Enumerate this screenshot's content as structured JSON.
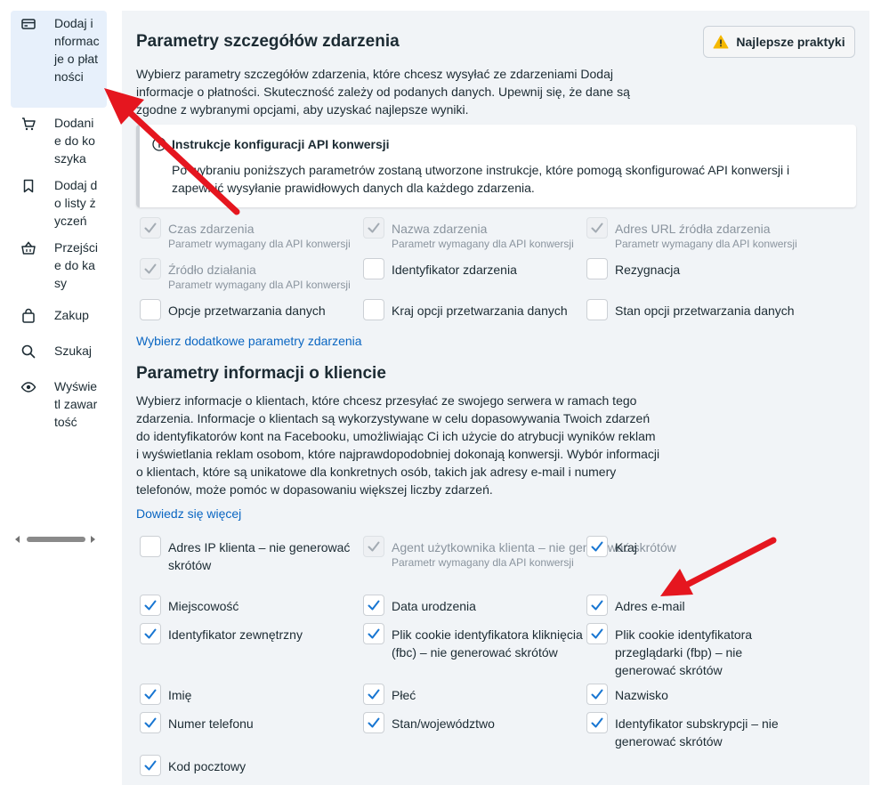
{
  "sidebar": {
    "items": [
      {
        "label": "Dodaj informacje o płatności",
        "icon": "credit-card-icon",
        "active": true
      },
      {
        "label": "Dodanie do koszyka",
        "icon": "cart-icon",
        "active": false
      },
      {
        "label": "Dodaj do listy życzeń",
        "icon": "bookmark-icon",
        "active": false
      },
      {
        "label": "Przejście do kasy",
        "icon": "basket-icon",
        "active": false
      },
      {
        "label": "Zakup",
        "icon": "shopping-bag-icon",
        "active": false
      },
      {
        "label": "Szukaj",
        "icon": "search-icon",
        "active": false
      },
      {
        "label": "Wyświetl zawartość",
        "icon": "eye-icon",
        "active": false
      }
    ]
  },
  "event_params": {
    "title": "Parametry szczegółów zdarzenia",
    "best_practices_label": "Najlepsze praktyki",
    "description": "Wybierz parametry szczegółów zdarzenia, które chcesz wysyłać ze zdarzeniami Dodaj informacje o płatności. Skuteczność zależy od podanych danych. Upewnij się, że dane są zgodne z wybranymi opcjami, aby uzyskać najlepsze wyniki.",
    "info_title": "Instrukcje konfiguracji API konwersji",
    "info_body": "Po wybraniu poniższych parametrów zostaną utworzone instrukcje, które pomogą skonfigurować API konwersji i zapewnić wysyłanie prawidłowych danych dla każdego zdarzenia.",
    "options": [
      {
        "label": "Czas zdarzenia",
        "sub": "Parametr wymagany dla API konwersji",
        "checked": true,
        "disabled": true
      },
      {
        "label": "Nazwa zdarzenia",
        "sub": "Parametr wymagany dla API konwersji",
        "checked": true,
        "disabled": true
      },
      {
        "label": "Adres URL źródła zdarzenia",
        "sub": "Parametr wymagany dla API konwersji",
        "checked": true,
        "disabled": true
      },
      {
        "label": "Źródło działania",
        "sub": "Parametr wymagany dla API konwersji",
        "checked": true,
        "disabled": true
      },
      {
        "label": "Identyfikator zdarzenia",
        "checked": false,
        "disabled": false
      },
      {
        "label": "Rezygnacja",
        "checked": false,
        "disabled": false
      },
      {
        "label": "Opcje przetwarzania danych",
        "checked": false,
        "disabled": false
      },
      {
        "label": "Kraj opcji przetwarzania danych",
        "checked": false,
        "disabled": false
      },
      {
        "label": "Stan opcji przetwarzania danych",
        "checked": false,
        "disabled": false
      }
    ],
    "more_link": "Wybierz dodatkowe parametry zdarzenia"
  },
  "customer_params": {
    "title": "Parametry informacji o kliencie",
    "description": "Wybierz informacje o klientach, które chcesz przesyłać ze swojego serwera w ramach tego zdarzenia. Informacje o klientach są wykorzystywane w celu dopasowywania Twoich zdarzeń do identyfikatorów kont na Facebooku, umożliwiając Ci ich użycie do atrybucji wyników reklam i wyświetlania reklam osobom, które najprawdopodobniej dokonają konwersji. Wybór informacji o klientach, które są unikatowe dla konkretnych osób, takich jak adresy e-mail i numery telefonów, może pomóc w dopasowaniu większej liczby zdarzeń.",
    "learn_more": "Dowiedz się więcej",
    "options": [
      {
        "label": "Adres IP klienta – nie generować skrótów",
        "checked": false,
        "disabled": false
      },
      {
        "label": "Agent użytkownika klienta – nie generować skrótów",
        "sub": "Parametr wymagany dla API konwersji",
        "checked": true,
        "disabled": true
      },
      {
        "label": "Kraj",
        "checked": true,
        "disabled": false
      },
      {
        "label": "Miejscowość",
        "checked": true,
        "disabled": false
      },
      {
        "label": "Data urodzenia",
        "checked": true,
        "disabled": false
      },
      {
        "label": "Adres e-mail",
        "checked": true,
        "disabled": false
      },
      {
        "label": "Identyfikator zewnętrzny",
        "checked": true,
        "disabled": false
      },
      {
        "label": "Plik cookie identyfikatora kliknięcia (fbc) – nie generować skrótów",
        "checked": true,
        "disabled": false
      },
      {
        "label": "Plik cookie identyfikatora przeglądarki (fbp) – nie generować skrótów",
        "checked": true,
        "disabled": false
      },
      {
        "label": "Imię",
        "checked": true,
        "disabled": false
      },
      {
        "label": "Płeć",
        "checked": true,
        "disabled": false
      },
      {
        "label": "Nazwisko",
        "checked": true,
        "disabled": false
      },
      {
        "label": "Numer telefonu",
        "checked": true,
        "disabled": false
      },
      {
        "label": "Stan/województwo",
        "checked": true,
        "disabled": false
      },
      {
        "label": "Identyfikator subskrypcji – nie generować skrótów",
        "checked": true,
        "disabled": false
      },
      {
        "label": "Kod pocztowy",
        "checked": true,
        "disabled": false
      }
    ]
  },
  "colors": {
    "accent": "#0a66c2",
    "check_active": "#1876d2",
    "check_disabled": "#a3abb3",
    "annotation_arrow": "#e5161f"
  }
}
